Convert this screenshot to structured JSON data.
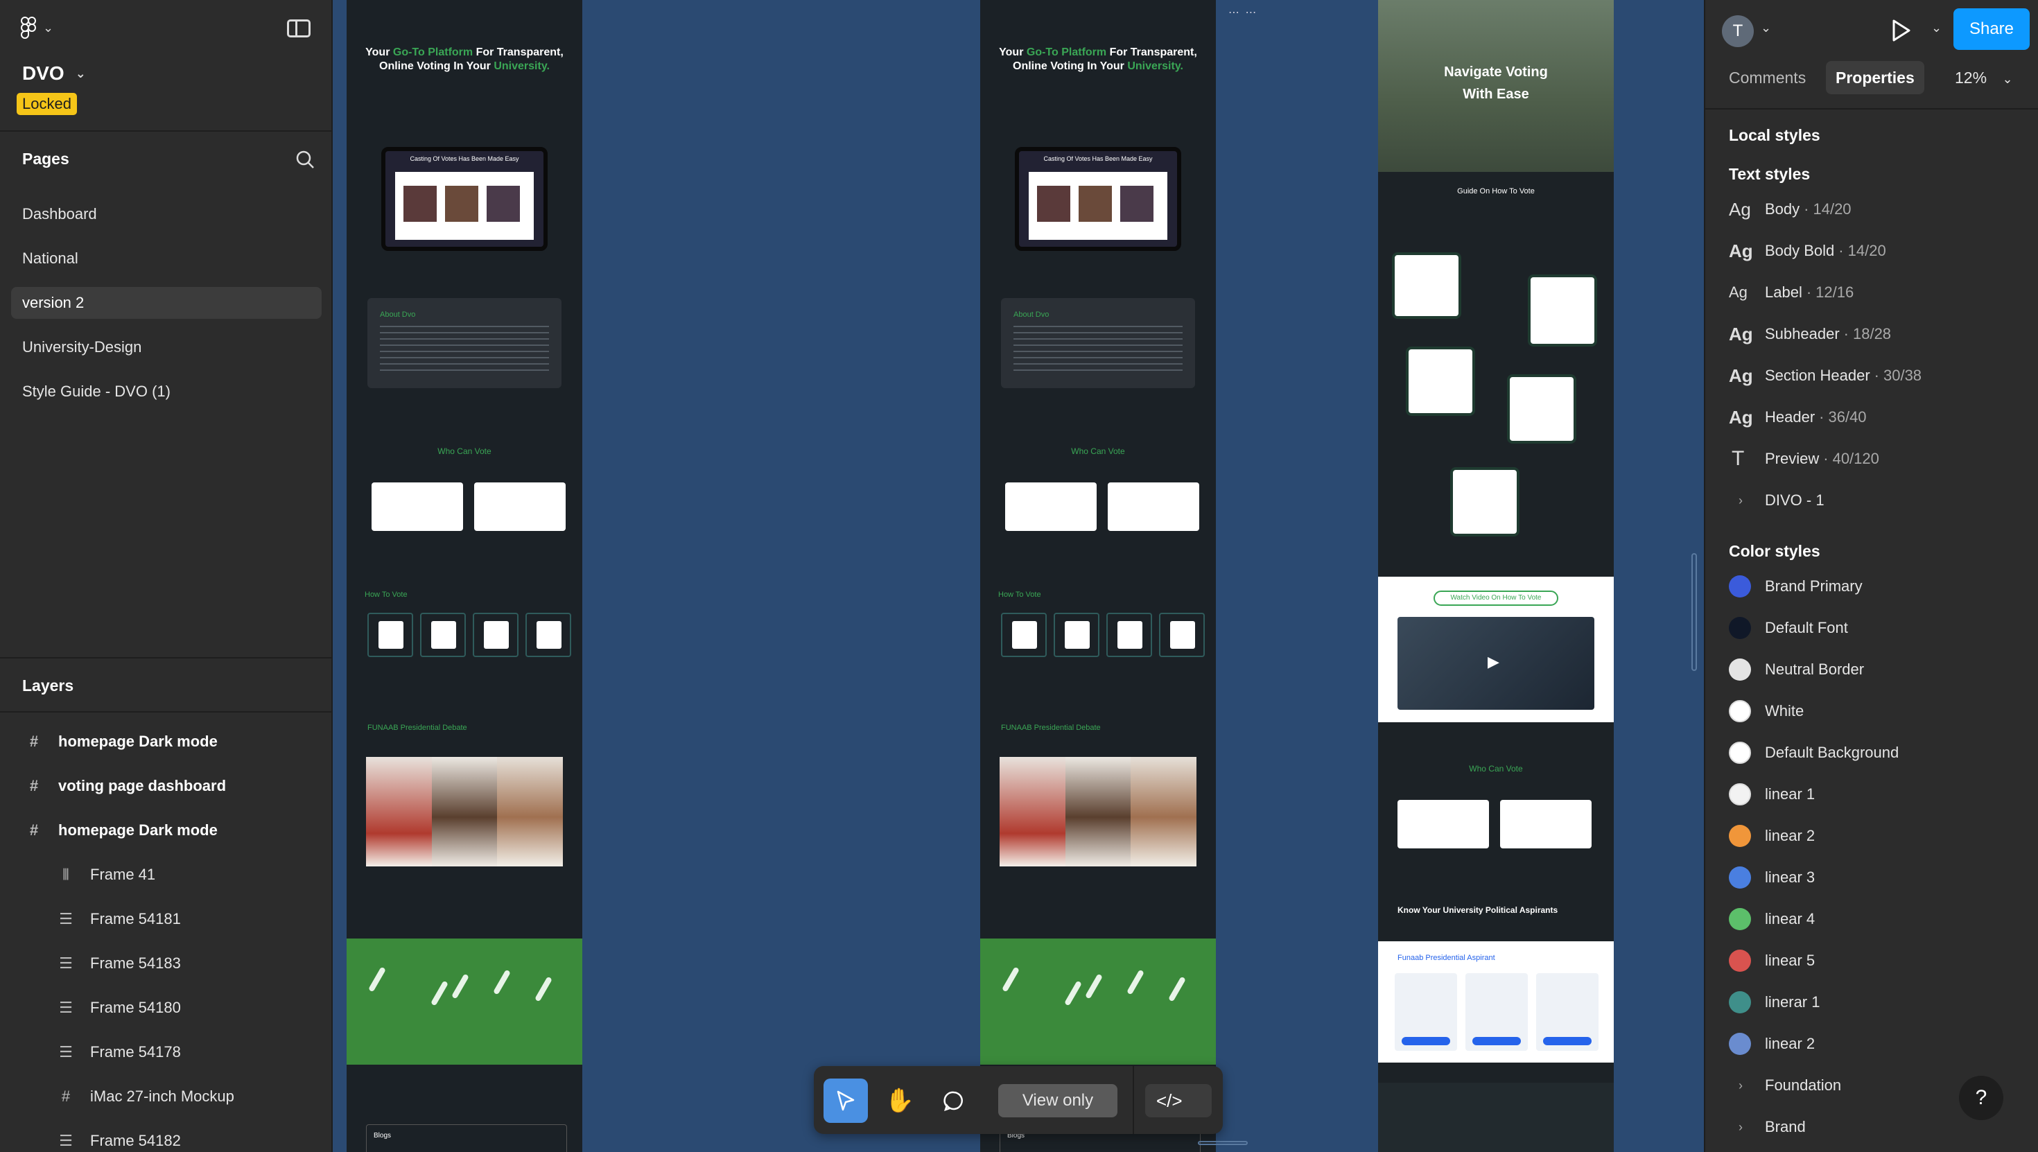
{
  "app": {
    "file_name": "DVO",
    "locked_badge": "Locked"
  },
  "pages": {
    "title": "Pages",
    "items": [
      "Dashboard",
      "National",
      "version 2",
      "University-Design",
      "Style Guide - DVO (1)"
    ],
    "active_index": 2
  },
  "layers": {
    "title": "Layers",
    "items": [
      {
        "label": "homepage Dark mode",
        "icon": "frame-icon",
        "level": 0
      },
      {
        "label": "voting page dashboard",
        "icon": "frame-icon",
        "level": 0
      },
      {
        "label": "homepage Dark mode",
        "icon": "frame-icon",
        "level": 0
      },
      {
        "label": "Frame 41",
        "icon": "auto-layout-icon",
        "level": 1
      },
      {
        "label": "Frame 54181",
        "icon": "auto-layout-icon",
        "level": 1
      },
      {
        "label": "Frame 54183",
        "icon": "auto-layout-icon",
        "level": 1
      },
      {
        "label": "Frame 54180",
        "icon": "auto-layout-icon",
        "level": 1
      },
      {
        "label": "Frame 54178",
        "icon": "auto-layout-icon",
        "level": 1
      },
      {
        "label": "iMac 27-inch Mockup",
        "icon": "frame-icon",
        "level": 1
      },
      {
        "label": "Frame 54182",
        "icon": "auto-layout-icon",
        "level": 1
      }
    ]
  },
  "canvas": {
    "hero_line1_pre": "Your ",
    "hero_line1_green": "Go-To Platform",
    "hero_line1_post": " For Transparent,",
    "hero_line2_pre": "Online Voting In Your ",
    "hero_line2_green": "University.",
    "laptop_caption": "Casting Of Votes Has Been Made Easy",
    "about_title": "About Dvo",
    "who_can_vote": "Who Can Vote",
    "how_to_vote": "How To Vote",
    "debate_title": "FUNAAB Presidential Debate",
    "blogs": "Blogs",
    "nav_title": "Navigate Voting With Ease",
    "guide_title": "Guide On How To Vote",
    "watch_video": "Watch Video On How To Vote",
    "know_aspirants": "Know Your University Political Aspirants",
    "aspirant_title": "Funaab Presidential Aspirant"
  },
  "toolbar": {
    "view_only": "View only"
  },
  "right": {
    "avatar_initial": "T",
    "share": "Share",
    "tabs": [
      "Comments",
      "Properties"
    ],
    "active_tab": 1,
    "zoom": "12%",
    "local_styles": "Local styles",
    "text_styles_title": "Text styles",
    "text_styles": [
      {
        "name": "Body",
        "meta": "14/20",
        "bold": false,
        "icon": "ag"
      },
      {
        "name": "Body Bold",
        "meta": "14/20",
        "bold": true,
        "icon": "ag"
      },
      {
        "name": "Label",
        "meta": "12/16",
        "bold": false,
        "icon": "ag"
      },
      {
        "name": "Subheader",
        "meta": "18/28",
        "bold": true,
        "icon": "ag"
      },
      {
        "name": "Section Header",
        "meta": "30/38",
        "bold": true,
        "icon": "ag"
      },
      {
        "name": "Header",
        "meta": "36/40",
        "bold": true,
        "icon": "ag"
      },
      {
        "name": "Preview",
        "meta": "40/120",
        "bold": false,
        "icon": "type"
      },
      {
        "name": "DIVO - 1",
        "meta": "",
        "bold": false,
        "icon": "arrow"
      }
    ],
    "color_styles_title": "Color styles",
    "color_styles": [
      {
        "name": "Brand Primary",
        "color": "#3b5bdb"
      },
      {
        "name": "Default Font",
        "color": "#101828"
      },
      {
        "name": "Neutral Border",
        "color": "#e4e4e4"
      },
      {
        "name": "White",
        "color": "#ffffff"
      },
      {
        "name": "Default Background",
        "color": "#ffffff"
      },
      {
        "name": "linear 1",
        "color": "#f2f2f2"
      },
      {
        "name": "linear 2",
        "color": "#f0963a"
      },
      {
        "name": "linear 3",
        "color": "#4a7fe0"
      },
      {
        "name": "linear 4",
        "color": "#5cbf6a"
      },
      {
        "name": "linear 5",
        "color": "#d9534f"
      },
      {
        "name": "linerar 1",
        "color": "#3f8f8a"
      },
      {
        "name": "linear 2",
        "color": "#6a8ccf"
      }
    ],
    "groups": [
      "Foundation",
      "Brand"
    ]
  }
}
